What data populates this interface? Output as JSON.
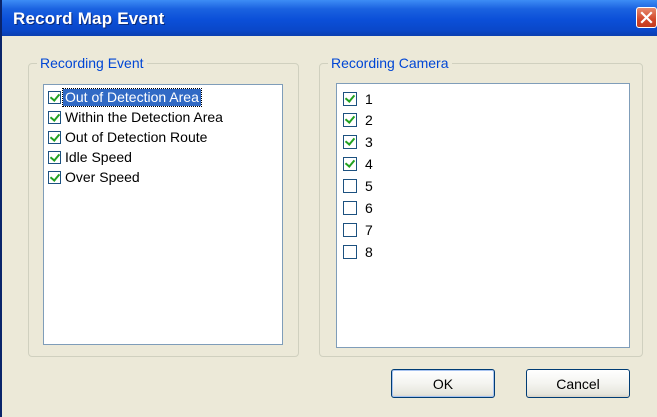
{
  "window": {
    "title": "Record Map Event"
  },
  "recording_event": {
    "label": "Recording Event",
    "items": [
      {
        "label": "Out of Detection Area",
        "checked": true,
        "selected": true
      },
      {
        "label": "Within the Detection Area",
        "checked": true,
        "selected": false
      },
      {
        "label": "Out of Detection Route",
        "checked": true,
        "selected": false
      },
      {
        "label": "Idle Speed",
        "checked": true,
        "selected": false
      },
      {
        "label": "Over Speed",
        "checked": true,
        "selected": false
      }
    ]
  },
  "recording_camera": {
    "label": "Recording Camera",
    "items": [
      {
        "label": "1",
        "checked": true
      },
      {
        "label": "2",
        "checked": true
      },
      {
        "label": "3",
        "checked": true
      },
      {
        "label": "4",
        "checked": true
      },
      {
        "label": "5",
        "checked": false
      },
      {
        "label": "6",
        "checked": false
      },
      {
        "label": "7",
        "checked": false
      },
      {
        "label": "8",
        "checked": false
      }
    ]
  },
  "buttons": {
    "ok": "OK",
    "cancel": "Cancel"
  }
}
